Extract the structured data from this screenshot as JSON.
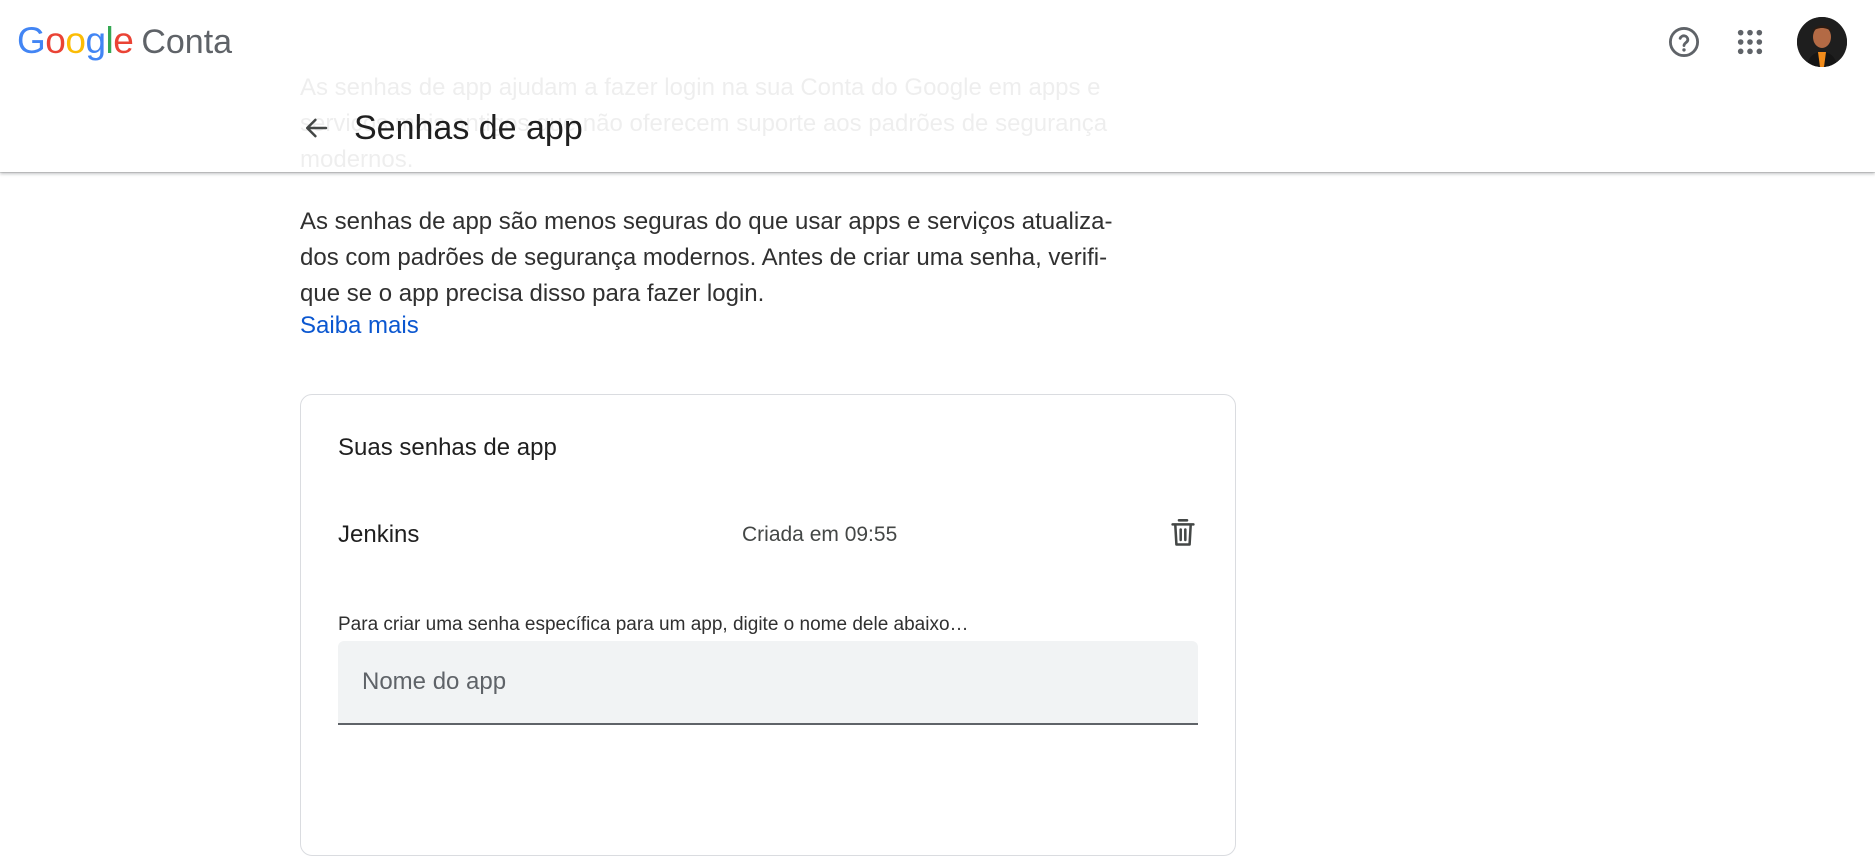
{
  "header": {
    "brand_google": [
      "G",
      "o",
      "o",
      "g",
      "l",
      "e"
    ],
    "brand_colors": [
      "#4285F4",
      "#EA4335",
      "#FBBC05",
      "#4285F4",
      "#34A853",
      "#EA4335"
    ],
    "brand_product": "Conta",
    "help_icon": "help-circle-icon",
    "apps_icon": "apps-grid-icon",
    "avatar": "profile-photo"
  },
  "page": {
    "title": "Senhas de app",
    "back_icon": "arrow-back-icon",
    "ghost_text": "As senhas de app ajudam a fazer login na sua Conta do Google em apps e serviços mais antigos que não oferecem suporte aos padrões de segurança modernos.",
    "intro": "As senhas de app são menos seguras do que usar apps e serviços atualiza-dos com padrões de segurança modernos. Antes de criar uma senha, verifi-que se o app precisa disso para fazer login.",
    "learn_more": "Saiba mais"
  },
  "card": {
    "title": "Suas senhas de app",
    "passwords": [
      {
        "name": "Jenkins",
        "created": "Criada em 09:55",
        "delete_icon": "trash-icon"
      }
    ],
    "hint": "Para criar uma senha específica para um app, digite o nome dele abaixo…",
    "input_placeholder": "Nome do app",
    "input_value": ""
  },
  "colors": {
    "link": "#0b57d0",
    "field_bg": "#f1f3f4",
    "card_border": "#dadce0"
  }
}
